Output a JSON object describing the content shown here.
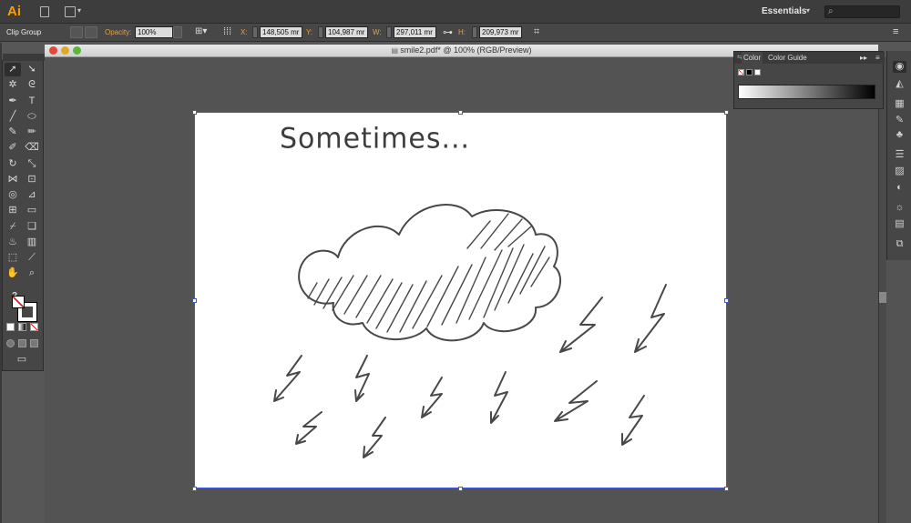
{
  "app": {
    "logo": "Ai"
  },
  "menubar": {
    "workspace": "Essentials",
    "workspace_caret": "▾"
  },
  "controlbar": {
    "object_type": "Clip Group",
    "opacity_label": "Opacity:",
    "opacity_value": "100%",
    "x_label": "X:",
    "x_value": "148,505 mr",
    "y_label": "Y:",
    "y_value": "104,987 mr",
    "w_label": "W:",
    "w_value": "297,011 mr",
    "h_label": "H:",
    "h_value": "209,973 mr"
  },
  "document": {
    "tab_title": "smile2.pdf* @ 100% (RGB/Preview)",
    "artwork_text": "Sometimes...",
    "artwork_scene": "hand-drawn storm cloud with lightning bolts"
  },
  "tools": {
    "help": "?"
  },
  "color_panel": {
    "tab_color": "Color",
    "tab_color_guide": "Color Guide",
    "menu": "▸▸"
  },
  "colors": {
    "accent": "#ff9a00",
    "selection": "#3b5bd8",
    "panel": "#464646",
    "pasteboard": "#535353"
  }
}
